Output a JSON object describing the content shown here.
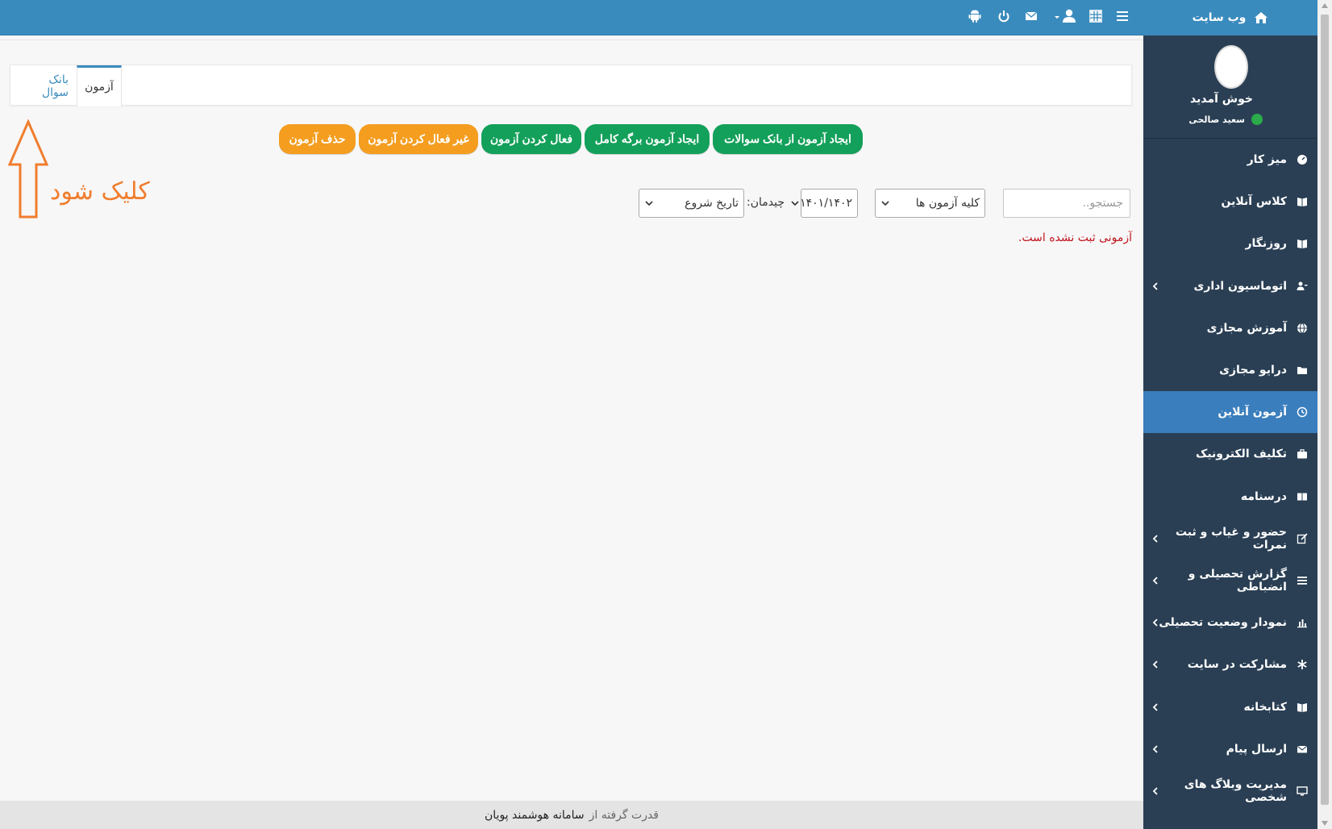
{
  "sidebar": {
    "brand": "وب سایت",
    "welcome": "خوش آمدید",
    "username": "سعید صالحی",
    "items": [
      {
        "label": "میز کار",
        "icon": "dashboard-icon",
        "has_children": false,
        "active": false
      },
      {
        "label": "کلاس آنلاین",
        "icon": "book-icon",
        "has_children": false,
        "active": false
      },
      {
        "label": "روزنگار",
        "icon": "book-icon",
        "has_children": false,
        "active": false
      },
      {
        "label": "اتوماسیون اداری",
        "icon": "users-icon",
        "has_children": true,
        "active": false
      },
      {
        "label": "آموزش مجازی",
        "icon": "globe-icon",
        "has_children": false,
        "active": false
      },
      {
        "label": "درایو مجازی",
        "icon": "folder-icon",
        "has_children": false,
        "active": false
      },
      {
        "label": "آزمون آنلاین",
        "icon": "clock-icon",
        "has_children": false,
        "active": true
      },
      {
        "label": "تکلیف الکترونیک",
        "icon": "briefcase-icon",
        "has_children": false,
        "active": false
      },
      {
        "label": "درسنامه",
        "icon": "book-open-icon",
        "has_children": false,
        "active": false
      },
      {
        "label": "حضور و غیاب و ثبت نمرات",
        "icon": "edit-icon",
        "has_children": true,
        "active": false
      },
      {
        "label": "گزارش تحصیلی و انضباطی",
        "icon": "list-icon",
        "has_children": true,
        "active": false
      },
      {
        "label": "نمودار وضعیت تحصیلی",
        "icon": "bar-chart-icon",
        "has_children": true,
        "active": false
      },
      {
        "label": "مشارکت در سایت",
        "icon": "asterisk-icon",
        "has_children": true,
        "active": false
      },
      {
        "label": "کتابخانه",
        "icon": "book-icon",
        "has_children": true,
        "active": false
      },
      {
        "label": "ارسال پیام",
        "icon": "envelope-icon",
        "has_children": true,
        "active": false
      },
      {
        "label": "مدیریت وبلاگ های شخصی",
        "icon": "desktop-icon",
        "has_children": true,
        "active": false
      }
    ]
  },
  "tabs": {
    "exam": "آزمون",
    "bank": "بانک سوال"
  },
  "actions": {
    "create_from_bank": "ایجاد آزمون از بانک سوالات",
    "create_full_sheet": "ایجاد آزمون برگه کامل",
    "activate": "فعال کردن آزمون",
    "deactivate": "غیر فعال کردن آزمون",
    "delete": "حذف آزمون"
  },
  "filters": {
    "search_placeholder": "جستجو..",
    "exam_scope": "کلیه آزمون ها",
    "year": "۱۴۰۱/۱۴۰۲",
    "sort_label": "چیدمان:",
    "sort_value": "تاریخ شروع"
  },
  "empty_message": "آزمونی ثبت نشده است.",
  "annotation": "کلیک شود",
  "footer": {
    "prefix": "قدرت گرفته از",
    "brand": "سامانه هوشمند پویان"
  },
  "colors": {
    "topbar": "#3a8bbd",
    "sidebar": "#2a3f54",
    "active_item": "#3a7ebd",
    "green_button": "#13a05a",
    "orange_button": "#f49d1f",
    "error_text": "#c0151f",
    "annotation": "#f07d2e"
  }
}
